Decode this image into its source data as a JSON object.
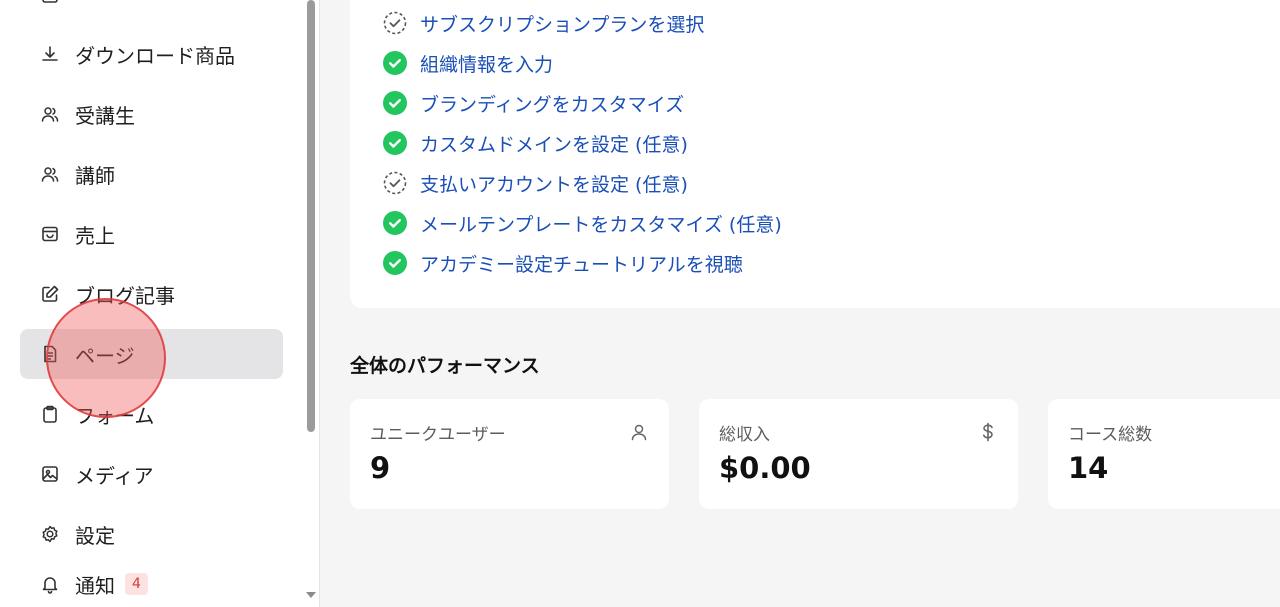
{
  "sidebar": {
    "items": [
      {
        "label": "ダウンロード商品",
        "icon": "download-icon"
      },
      {
        "label": "受講生",
        "icon": "users-icon"
      },
      {
        "label": "講師",
        "icon": "users-icon"
      },
      {
        "label": "売上",
        "icon": "shopping-bag-icon"
      },
      {
        "label": "ブログ記事",
        "icon": "edit-icon"
      },
      {
        "label": "ページ",
        "icon": "file-text-icon",
        "active": true
      },
      {
        "label": "フォーム",
        "icon": "clipboard-icon"
      },
      {
        "label": "メディア",
        "icon": "image-icon"
      },
      {
        "label": "設定",
        "icon": "gear-icon"
      },
      {
        "label": "通知",
        "icon": "bell-icon",
        "badge": "4"
      }
    ]
  },
  "checklist": {
    "tasks": [
      {
        "label": "サブスクリプションプランを選択",
        "done": false
      },
      {
        "label": "組織情報を入力",
        "done": true
      },
      {
        "label": "ブランディングをカスタマイズ",
        "done": true
      },
      {
        "label": "カスタムドメインを設定 (任意)",
        "done": true
      },
      {
        "label": "支払いアカウントを設定 (任意)",
        "done": false
      },
      {
        "label": "メールテンプレートをカスタマイズ (任意)",
        "done": true
      },
      {
        "label": "アカデミー設定チュートリアルを視聴",
        "done": true
      }
    ]
  },
  "performance": {
    "title": "全体のパフォーマンス",
    "stats": [
      {
        "label": "ユニークユーザー",
        "value": "9",
        "icon": "user-icon"
      },
      {
        "label": "総収入",
        "value": "$0.00",
        "icon": "dollar-icon"
      },
      {
        "label": "コース総数",
        "value": "14",
        "icon": ""
      }
    ]
  },
  "colors": {
    "accent_link": "#1a4fb8",
    "success": "#22c55e",
    "active_nav_bg": "#e4e4e6",
    "badge_bg": "#fde2e2",
    "badge_text": "#d83a3a"
  }
}
